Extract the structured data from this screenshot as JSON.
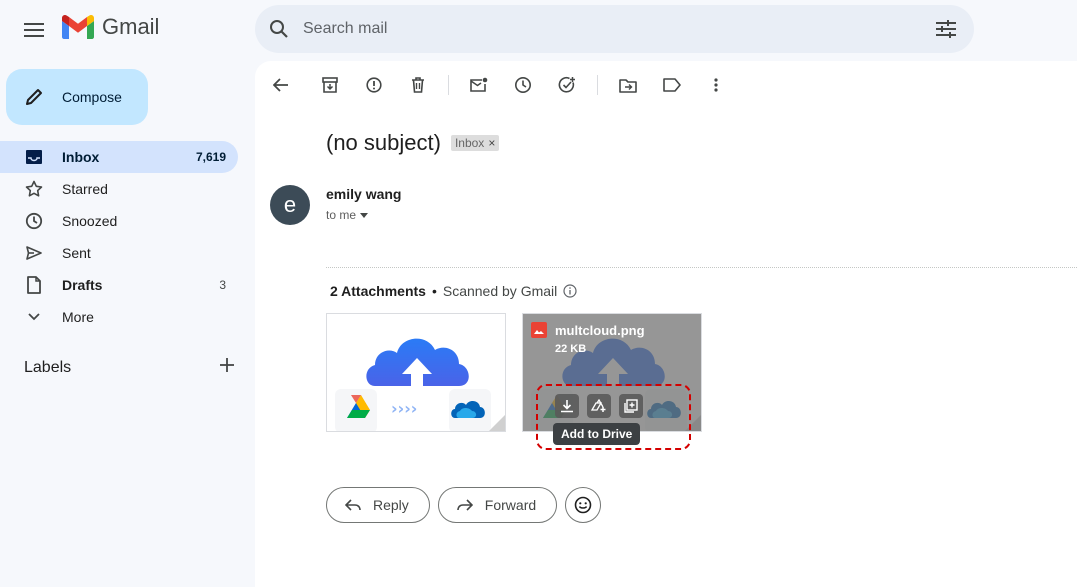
{
  "header": {
    "app_name": "Gmail",
    "search_placeholder": "Search mail"
  },
  "sidebar": {
    "compose_label": "Compose",
    "items": [
      {
        "label": "Inbox",
        "count": "7,619",
        "icon": "inbox-icon"
      },
      {
        "label": "Starred",
        "count": "",
        "icon": "star-icon"
      },
      {
        "label": "Snoozed",
        "count": "",
        "icon": "clock-icon"
      },
      {
        "label": "Sent",
        "count": "",
        "icon": "send-icon"
      },
      {
        "label": "Drafts",
        "count": "3",
        "icon": "draft-icon"
      },
      {
        "label": "More",
        "count": "",
        "icon": "chevron-down-icon"
      }
    ],
    "labels_heading": "Labels"
  },
  "message": {
    "subject": "(no subject)",
    "label_chip": "Inbox",
    "chip_close": "×",
    "avatar_letter": "e",
    "sender": "emily wang",
    "recipient_line": "to me",
    "attachments_count_label": "2 Attachments",
    "separator": "•",
    "scanned_label": "Scanned by Gmail",
    "attachments": [
      {
        "file_name": "multcloud.png",
        "file_size": "22 KB"
      }
    ],
    "tooltip": "Add to Drive"
  },
  "actions": {
    "reply_label": "Reply",
    "forward_label": "Forward"
  },
  "colors": {
    "accent": "#c2e7ff",
    "active_nav": "#d3e3fd",
    "highlight_dash": "#d40000"
  }
}
